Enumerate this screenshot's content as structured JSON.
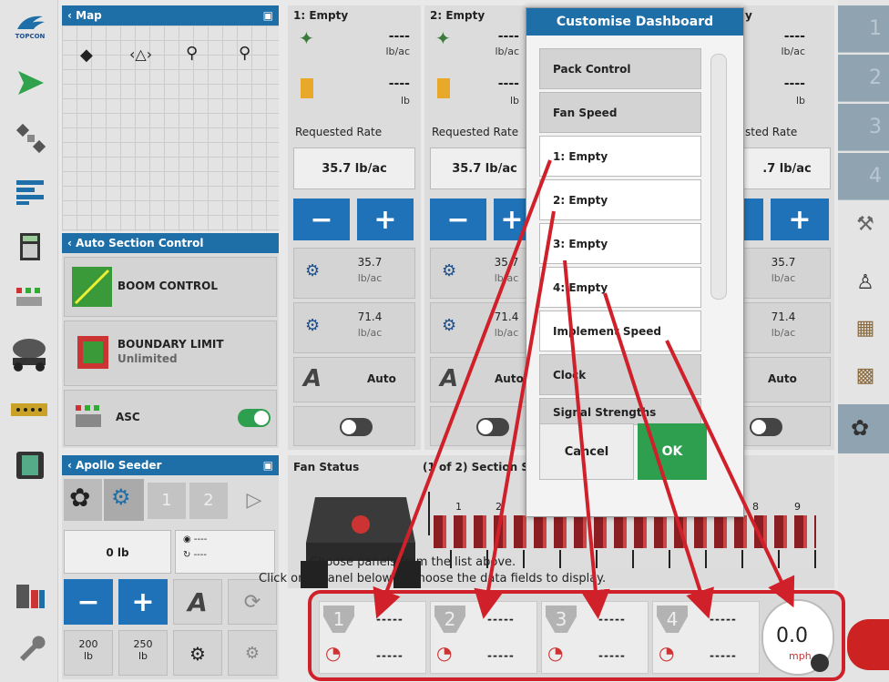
{
  "map": {
    "header": "Map"
  },
  "asc_panel": {
    "header": "Auto Section Control",
    "boom_control": "BOOM CONTROL",
    "boundary_limit": "BOUNDARY LIMIT",
    "boundary_value": "Unlimited",
    "asc_label": "ASC"
  },
  "apollo": {
    "header": "Apollo Seeder",
    "weight": "0 lb",
    "dash_a": "----",
    "dash_b": "----",
    "preset1_value": "200",
    "preset1_unit": "lb",
    "preset2_value": "250",
    "preset2_unit": "lb",
    "tab1": "1",
    "tab2": "2"
  },
  "columns": [
    {
      "title": "1: Empty",
      "product_dash": "----",
      "product_unit": "lb/ac",
      "bin_dash": "----",
      "bin_unit": "lb",
      "requested_label": "Requested Rate",
      "requested_value": "35.7 lb/ac",
      "preset1_value": "35.7",
      "preset1_unit": "lb/ac",
      "preset2_value": "71.4",
      "preset2_unit": "lb/ac",
      "auto_label": "Auto"
    },
    {
      "title": "2: Empty",
      "product_dash": "----",
      "product_unit": "lb/ac",
      "bin_dash": "----",
      "bin_unit": "lb",
      "requested_label": "Requested Rate",
      "requested_value": "35.7 lb/ac",
      "preset1_value": "35.7",
      "preset1_unit": "lb/ac",
      "preset2_value": "71.4",
      "preset2_unit": "lb/ac",
      "auto_label": "Auto"
    },
    {
      "title": "y",
      "product_dash": "----",
      "product_unit": "lb/ac",
      "bin_dash": "----",
      "bin_unit": "lb",
      "requested_label": "sted Rate",
      "requested_value": ".7 lb/ac",
      "preset1_value": "35.7",
      "preset1_unit": "lb/ac",
      "preset2_value": "71.4",
      "preset2_unit": "lb/ac",
      "auto_label": "Auto"
    }
  ],
  "fan_status": {
    "label": "Fan Status"
  },
  "section_status": {
    "label": "(1 of 2) Section S",
    "numbers": [
      "1",
      "2",
      "8",
      "9"
    ]
  },
  "instructions": {
    "line1": "Choose panels from the list above.",
    "line2": "Click on a panel below to choose the data fields to display."
  },
  "dialog": {
    "title": "Customise Dashboard",
    "items": [
      {
        "label": "Pack Control",
        "selected": true
      },
      {
        "label": "Fan Speed",
        "selected": true
      },
      {
        "label": "1: Empty",
        "selected": false
      },
      {
        "label": "2: Empty",
        "selected": false
      },
      {
        "label": "3: Empty",
        "selected": false
      },
      {
        "label": "4: Empty",
        "selected": false
      },
      {
        "label": "Implement Speed",
        "selected": false
      },
      {
        "label": "Clock",
        "selected": true
      },
      {
        "label": "Signal Strengths",
        "selected": true
      }
    ],
    "cancel_label": "Cancel",
    "ok_label": "OK"
  },
  "mini_dashboard": {
    "cells": [
      {
        "num": "1",
        "top": "-----",
        "bottom": "-----"
      },
      {
        "num": "2",
        "top": "-----",
        "bottom": "-----"
      },
      {
        "num": "3",
        "top": "-----",
        "bottom": "-----"
      },
      {
        "num": "4",
        "top": "-----",
        "bottom": "-----"
      }
    ],
    "speed_value": "0.0",
    "speed_unit": "mph"
  },
  "right_tabs": [
    "1",
    "2",
    "3",
    "4"
  ],
  "colors": {
    "accent": "#1e6fa8",
    "ok": "#2e9e4f",
    "highlight": "#d0202a"
  },
  "icons": [
    "topcon-logo-icon",
    "guidance-arrow-icon",
    "satellite-icon",
    "sections-icon",
    "calculator-icon",
    "asc-switches-icon",
    "seeder-icon",
    "harness-icon",
    "film-icon",
    "bins-icon",
    "wrench-icon",
    "layers-icon",
    "pan-icon",
    "zoom-out-icon",
    "zoom-in-icon",
    "fan-icon",
    "speedometer-icon"
  ]
}
